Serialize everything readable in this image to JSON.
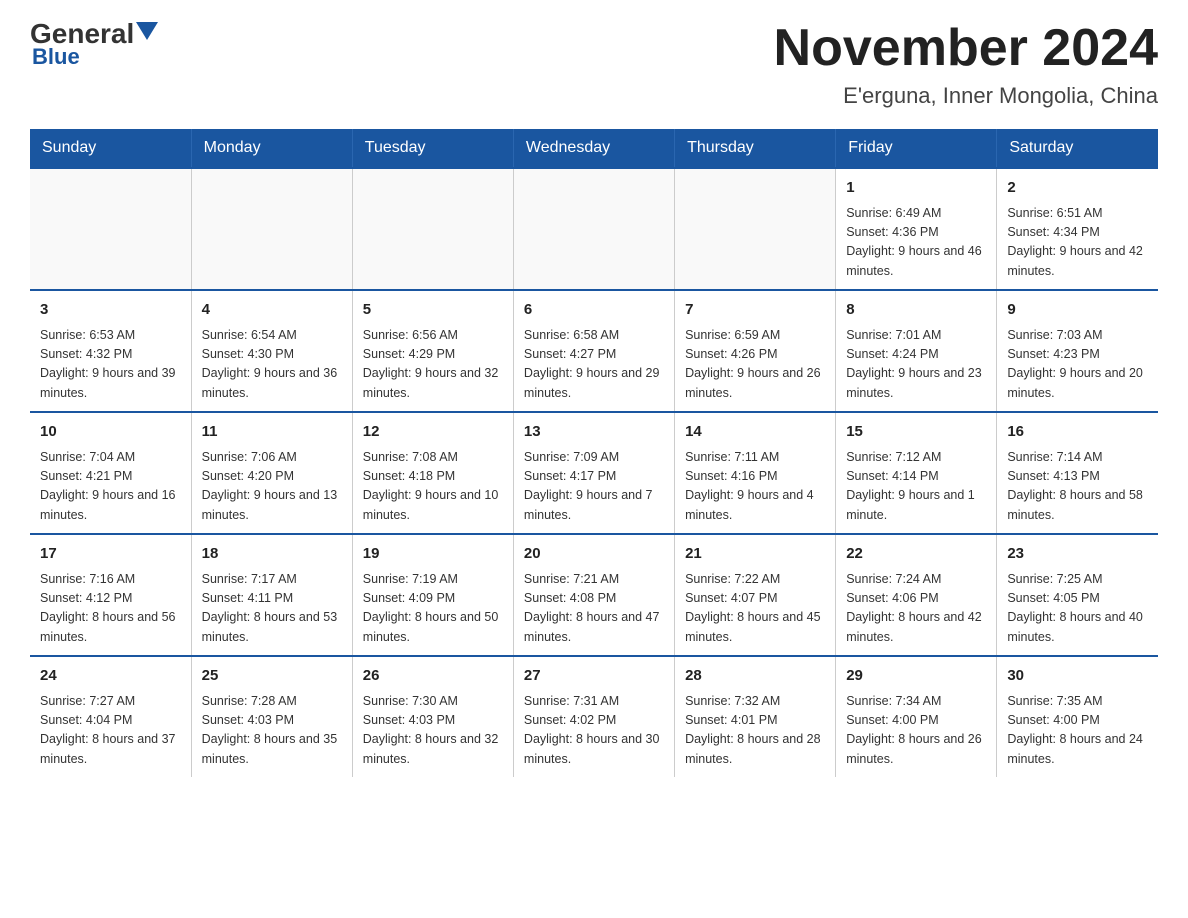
{
  "header": {
    "logo_general": "General",
    "logo_blue": "Blue",
    "month_title": "November 2024",
    "location": "E'erguna, Inner Mongolia, China"
  },
  "days_of_week": [
    "Sunday",
    "Monday",
    "Tuesday",
    "Wednesday",
    "Thursday",
    "Friday",
    "Saturday"
  ],
  "weeks": [
    {
      "days": [
        {
          "number": "",
          "sunrise": "",
          "sunset": "",
          "daylight": "",
          "empty": true
        },
        {
          "number": "",
          "sunrise": "",
          "sunset": "",
          "daylight": "",
          "empty": true
        },
        {
          "number": "",
          "sunrise": "",
          "sunset": "",
          "daylight": "",
          "empty": true
        },
        {
          "number": "",
          "sunrise": "",
          "sunset": "",
          "daylight": "",
          "empty": true
        },
        {
          "number": "",
          "sunrise": "",
          "sunset": "",
          "daylight": "",
          "empty": true
        },
        {
          "number": "1",
          "sunrise": "Sunrise: 6:49 AM",
          "sunset": "Sunset: 4:36 PM",
          "daylight": "Daylight: 9 hours and 46 minutes.",
          "empty": false
        },
        {
          "number": "2",
          "sunrise": "Sunrise: 6:51 AM",
          "sunset": "Sunset: 4:34 PM",
          "daylight": "Daylight: 9 hours and 42 minutes.",
          "empty": false
        }
      ]
    },
    {
      "days": [
        {
          "number": "3",
          "sunrise": "Sunrise: 6:53 AM",
          "sunset": "Sunset: 4:32 PM",
          "daylight": "Daylight: 9 hours and 39 minutes.",
          "empty": false
        },
        {
          "number": "4",
          "sunrise": "Sunrise: 6:54 AM",
          "sunset": "Sunset: 4:30 PM",
          "daylight": "Daylight: 9 hours and 36 minutes.",
          "empty": false
        },
        {
          "number": "5",
          "sunrise": "Sunrise: 6:56 AM",
          "sunset": "Sunset: 4:29 PM",
          "daylight": "Daylight: 9 hours and 32 minutes.",
          "empty": false
        },
        {
          "number": "6",
          "sunrise": "Sunrise: 6:58 AM",
          "sunset": "Sunset: 4:27 PM",
          "daylight": "Daylight: 9 hours and 29 minutes.",
          "empty": false
        },
        {
          "number": "7",
          "sunrise": "Sunrise: 6:59 AM",
          "sunset": "Sunset: 4:26 PM",
          "daylight": "Daylight: 9 hours and 26 minutes.",
          "empty": false
        },
        {
          "number": "8",
          "sunrise": "Sunrise: 7:01 AM",
          "sunset": "Sunset: 4:24 PM",
          "daylight": "Daylight: 9 hours and 23 minutes.",
          "empty": false
        },
        {
          "number": "9",
          "sunrise": "Sunrise: 7:03 AM",
          "sunset": "Sunset: 4:23 PM",
          "daylight": "Daylight: 9 hours and 20 minutes.",
          "empty": false
        }
      ]
    },
    {
      "days": [
        {
          "number": "10",
          "sunrise": "Sunrise: 7:04 AM",
          "sunset": "Sunset: 4:21 PM",
          "daylight": "Daylight: 9 hours and 16 minutes.",
          "empty": false
        },
        {
          "number": "11",
          "sunrise": "Sunrise: 7:06 AM",
          "sunset": "Sunset: 4:20 PM",
          "daylight": "Daylight: 9 hours and 13 minutes.",
          "empty": false
        },
        {
          "number": "12",
          "sunrise": "Sunrise: 7:08 AM",
          "sunset": "Sunset: 4:18 PM",
          "daylight": "Daylight: 9 hours and 10 minutes.",
          "empty": false
        },
        {
          "number": "13",
          "sunrise": "Sunrise: 7:09 AM",
          "sunset": "Sunset: 4:17 PM",
          "daylight": "Daylight: 9 hours and 7 minutes.",
          "empty": false
        },
        {
          "number": "14",
          "sunrise": "Sunrise: 7:11 AM",
          "sunset": "Sunset: 4:16 PM",
          "daylight": "Daylight: 9 hours and 4 minutes.",
          "empty": false
        },
        {
          "number": "15",
          "sunrise": "Sunrise: 7:12 AM",
          "sunset": "Sunset: 4:14 PM",
          "daylight": "Daylight: 9 hours and 1 minute.",
          "empty": false
        },
        {
          "number": "16",
          "sunrise": "Sunrise: 7:14 AM",
          "sunset": "Sunset: 4:13 PM",
          "daylight": "Daylight: 8 hours and 58 minutes.",
          "empty": false
        }
      ]
    },
    {
      "days": [
        {
          "number": "17",
          "sunrise": "Sunrise: 7:16 AM",
          "sunset": "Sunset: 4:12 PM",
          "daylight": "Daylight: 8 hours and 56 minutes.",
          "empty": false
        },
        {
          "number": "18",
          "sunrise": "Sunrise: 7:17 AM",
          "sunset": "Sunset: 4:11 PM",
          "daylight": "Daylight: 8 hours and 53 minutes.",
          "empty": false
        },
        {
          "number": "19",
          "sunrise": "Sunrise: 7:19 AM",
          "sunset": "Sunset: 4:09 PM",
          "daylight": "Daylight: 8 hours and 50 minutes.",
          "empty": false
        },
        {
          "number": "20",
          "sunrise": "Sunrise: 7:21 AM",
          "sunset": "Sunset: 4:08 PM",
          "daylight": "Daylight: 8 hours and 47 minutes.",
          "empty": false
        },
        {
          "number": "21",
          "sunrise": "Sunrise: 7:22 AM",
          "sunset": "Sunset: 4:07 PM",
          "daylight": "Daylight: 8 hours and 45 minutes.",
          "empty": false
        },
        {
          "number": "22",
          "sunrise": "Sunrise: 7:24 AM",
          "sunset": "Sunset: 4:06 PM",
          "daylight": "Daylight: 8 hours and 42 minutes.",
          "empty": false
        },
        {
          "number": "23",
          "sunrise": "Sunrise: 7:25 AM",
          "sunset": "Sunset: 4:05 PM",
          "daylight": "Daylight: 8 hours and 40 minutes.",
          "empty": false
        }
      ]
    },
    {
      "days": [
        {
          "number": "24",
          "sunrise": "Sunrise: 7:27 AM",
          "sunset": "Sunset: 4:04 PM",
          "daylight": "Daylight: 8 hours and 37 minutes.",
          "empty": false
        },
        {
          "number": "25",
          "sunrise": "Sunrise: 7:28 AM",
          "sunset": "Sunset: 4:03 PM",
          "daylight": "Daylight: 8 hours and 35 minutes.",
          "empty": false
        },
        {
          "number": "26",
          "sunrise": "Sunrise: 7:30 AM",
          "sunset": "Sunset: 4:03 PM",
          "daylight": "Daylight: 8 hours and 32 minutes.",
          "empty": false
        },
        {
          "number": "27",
          "sunrise": "Sunrise: 7:31 AM",
          "sunset": "Sunset: 4:02 PM",
          "daylight": "Daylight: 8 hours and 30 minutes.",
          "empty": false
        },
        {
          "number": "28",
          "sunrise": "Sunrise: 7:32 AM",
          "sunset": "Sunset: 4:01 PM",
          "daylight": "Daylight: 8 hours and 28 minutes.",
          "empty": false
        },
        {
          "number": "29",
          "sunrise": "Sunrise: 7:34 AM",
          "sunset": "Sunset: 4:00 PM",
          "daylight": "Daylight: 8 hours and 26 minutes.",
          "empty": false
        },
        {
          "number": "30",
          "sunrise": "Sunrise: 7:35 AM",
          "sunset": "Sunset: 4:00 PM",
          "daylight": "Daylight: 8 hours and 24 minutes.",
          "empty": false
        }
      ]
    }
  ]
}
